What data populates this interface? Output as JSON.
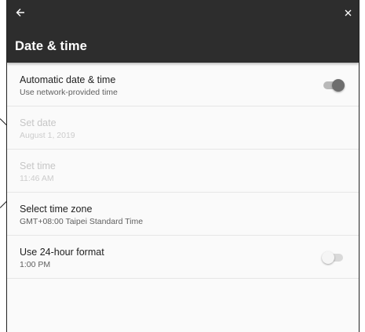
{
  "header": {
    "title": "Date & time",
    "back_icon": "arrow-back-icon",
    "close_icon": "close-icon"
  },
  "settings": [
    {
      "primary": "Automatic date & time",
      "secondary": "Use network-provided time",
      "enabled": true,
      "toggle": "on"
    },
    {
      "primary": "Set date",
      "secondary": "August 1, 2019",
      "enabled": false
    },
    {
      "primary": "Set time",
      "secondary": "11:46 AM",
      "enabled": false
    },
    {
      "primary": "Select time zone",
      "secondary": "GMT+08:00 Taipei Standard Time",
      "enabled": true
    },
    {
      "primary": "Use 24-hour format",
      "secondary": "1:00 PM",
      "enabled": true,
      "toggle": "off"
    }
  ],
  "colors": {
    "appbar": "#2d2d2d",
    "background": "#fafafa",
    "switch_on_thumb": "#6e6e6e",
    "switch_off_thumb": "#f5f5f5"
  }
}
